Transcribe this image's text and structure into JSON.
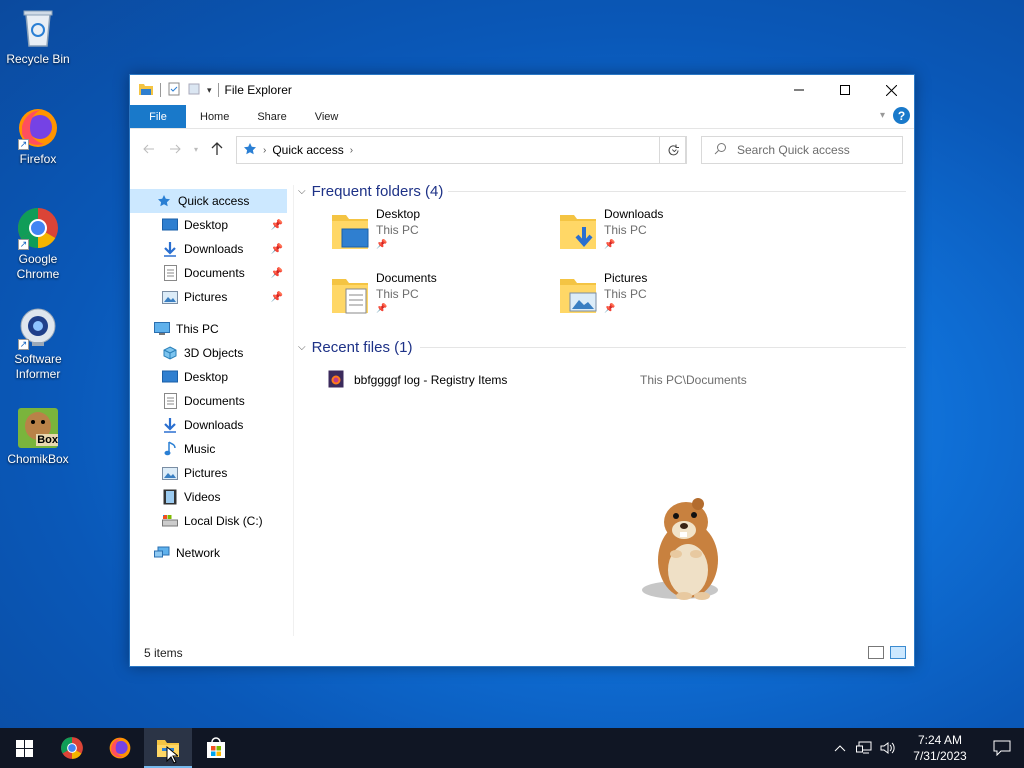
{
  "desktop": {
    "icons": [
      {
        "label": "Recycle Bin"
      },
      {
        "label": "Firefox"
      },
      {
        "label": "Google Chrome"
      },
      {
        "label": "Software Informer"
      },
      {
        "label": "ChomikBox"
      }
    ]
  },
  "window": {
    "title": "File Explorer",
    "ribbon_tabs": [
      "File",
      "Home",
      "Share",
      "View"
    ],
    "help_label": "?",
    "address": {
      "path": "Quick access"
    },
    "search_placeholder": "Search Quick access",
    "sidebar": {
      "quick_access": {
        "label": "Quick access",
        "items": [
          "Desktop",
          "Downloads",
          "Documents",
          "Pictures"
        ]
      },
      "this_pc": {
        "label": "This PC",
        "items": [
          "3D Objects",
          "Desktop",
          "Documents",
          "Downloads",
          "Music",
          "Pictures",
          "Videos",
          "Local Disk (C:)"
        ]
      },
      "network": {
        "label": "Network"
      }
    },
    "frequent": {
      "header": "Frequent folders (4)",
      "folders": [
        {
          "name": "Desktop",
          "location": "This PC"
        },
        {
          "name": "Downloads",
          "location": "This PC"
        },
        {
          "name": "Documents",
          "location": "This PC"
        },
        {
          "name": "Pictures",
          "location": "This PC"
        }
      ]
    },
    "recent": {
      "header": "Recent files (1)",
      "files": [
        {
          "name": "bbfggggf log - Registry Items",
          "path": "This PC\\Documents"
        }
      ]
    },
    "status": "5 items"
  },
  "taskbar": {
    "time": "7:24 AM",
    "date": "7/31/2023"
  },
  "colors": {
    "accent": "#1979ca",
    "selection": "#cce8ff",
    "group_header": "#1e3287",
    "taskbar": "#101624"
  }
}
